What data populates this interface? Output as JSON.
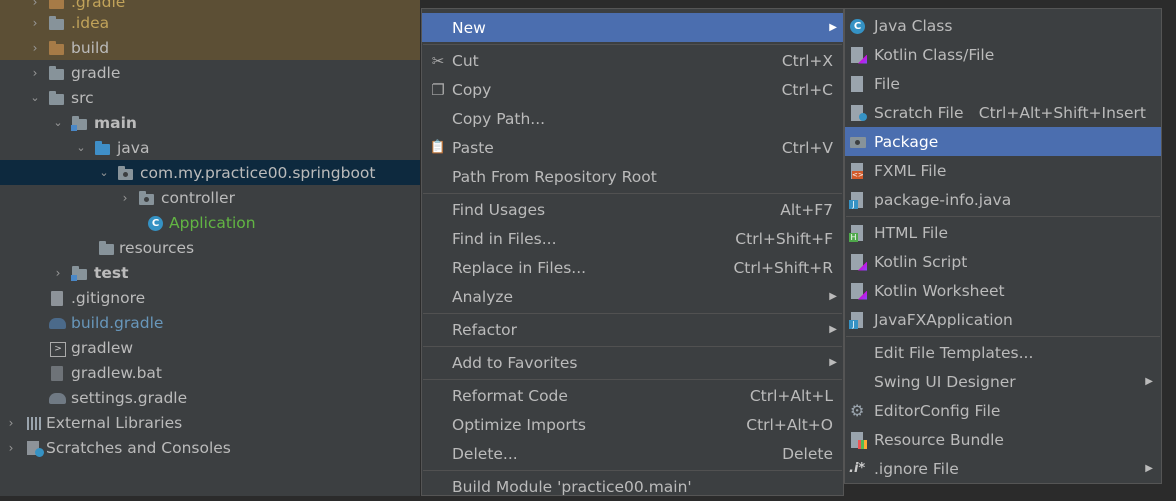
{
  "project_tree": {
    "items": [
      {
        "label": ".gradle",
        "arrow": "›",
        "icon": "folder-icon"
      },
      {
        "label": ".idea",
        "arrow": "›",
        "icon": "folder-icon"
      },
      {
        "label": "build",
        "arrow": "›",
        "icon": "folder-icon"
      },
      {
        "label": "gradle",
        "arrow": "›",
        "icon": "folder-icon"
      },
      {
        "label": "src",
        "arrow": "⌄",
        "icon": "folder-icon"
      },
      {
        "label": "main",
        "arrow": "⌄",
        "icon": "module-folder-icon"
      },
      {
        "label": "java",
        "arrow": "⌄",
        "icon": "source-folder-icon"
      },
      {
        "label": "com.my.practice00.springboot",
        "arrow": "⌄",
        "icon": "package-icon"
      },
      {
        "label": "controller",
        "arrow": "›",
        "icon": "package-icon"
      },
      {
        "label": "Application",
        "arrow": "",
        "icon": "spring-class-icon",
        "icon_char": "C"
      },
      {
        "label": "resources",
        "arrow": "",
        "icon": "resources-folder-icon"
      },
      {
        "label": "test",
        "arrow": "›",
        "icon": "module-folder-icon"
      },
      {
        "label": ".gitignore",
        "arrow": "",
        "icon": "file-icon"
      },
      {
        "label": "build.gradle",
        "arrow": "",
        "icon": "gradle-icon"
      },
      {
        "label": "gradlew",
        "arrow": "",
        "icon": "terminal-icon",
        "icon_char": ">"
      },
      {
        "label": "gradlew.bat",
        "arrow": "",
        "icon": "file-icon"
      },
      {
        "label": "settings.gradle",
        "arrow": "",
        "icon": "gradle-icon"
      },
      {
        "label": "External Libraries",
        "arrow": "›",
        "icon": "library-icon"
      },
      {
        "label": "Scratches and Consoles",
        "arrow": "›",
        "icon": "scratch-icon"
      }
    ]
  },
  "context_menu": {
    "items": [
      {
        "label": "New",
        "shortcut": "",
        "submenu_arrow": "▶",
        "icon": "",
        "active": true
      },
      {
        "label": "Cut",
        "shortcut": "Ctrl+X",
        "icon": "scissors-icon",
        "icon_char": "✂"
      },
      {
        "label": "Copy",
        "shortcut": "Ctrl+C",
        "icon": "copy-icon",
        "icon_char": "❐"
      },
      {
        "label": "Copy Path...",
        "shortcut": "",
        "icon": ""
      },
      {
        "label": "Paste",
        "shortcut": "Ctrl+V",
        "icon": "paste-icon",
        "icon_char": "📋"
      },
      {
        "label": "Path From Repository Root",
        "shortcut": "",
        "icon": ""
      },
      {
        "label": "Find Usages",
        "shortcut": "Alt+F7",
        "icon": ""
      },
      {
        "label": "Find in Files...",
        "shortcut": "Ctrl+Shift+F",
        "icon": ""
      },
      {
        "label": "Replace in Files...",
        "shortcut": "Ctrl+Shift+R",
        "icon": ""
      },
      {
        "label": "Analyze",
        "shortcut": "",
        "submenu_arrow": "▶",
        "icon": ""
      },
      {
        "label": "Refactor",
        "shortcut": "",
        "submenu_arrow": "▶",
        "icon": ""
      },
      {
        "label": "Add to Favorites",
        "shortcut": "",
        "submenu_arrow": "▶",
        "icon": ""
      },
      {
        "label": "Reformat Code",
        "shortcut": "Ctrl+Alt+L",
        "icon": ""
      },
      {
        "label": "Optimize Imports",
        "shortcut": "Ctrl+Alt+O",
        "icon": ""
      },
      {
        "label": "Delete...",
        "shortcut": "Delete",
        "icon": ""
      },
      {
        "label": "Build Module 'practice00.main'",
        "shortcut": "",
        "icon": ""
      }
    ]
  },
  "new_submenu": {
    "items": [
      {
        "label": "Java Class",
        "shortcut": "",
        "icon": "java-class-icon",
        "icon_char": "C"
      },
      {
        "label": "Kotlin Class/File",
        "shortcut": "",
        "icon": "kotlin-file-icon"
      },
      {
        "label": "File",
        "shortcut": "",
        "icon": "file-icon"
      },
      {
        "label": "Scratch File",
        "shortcut": "Ctrl+Alt+Shift+Insert",
        "icon": "scratch-file-icon"
      },
      {
        "label": "Package",
        "shortcut": "",
        "icon": "package-icon",
        "active": true
      },
      {
        "label": "FXML File",
        "shortcut": "",
        "icon": "fxml-file-icon"
      },
      {
        "label": "package-info.java",
        "shortcut": "",
        "icon": "java-file-icon"
      },
      {
        "label": "HTML File",
        "shortcut": "",
        "icon": "html-file-icon"
      },
      {
        "label": "Kotlin Script",
        "shortcut": "",
        "icon": "kotlin-script-icon"
      },
      {
        "label": "Kotlin Worksheet",
        "shortcut": "",
        "icon": "kotlin-worksheet-icon"
      },
      {
        "label": "JavaFXApplication",
        "shortcut": "",
        "icon": "javafx-icon"
      },
      {
        "label": "Edit File Templates...",
        "shortcut": "",
        "icon": ""
      },
      {
        "label": "Swing UI Designer",
        "shortcut": "",
        "submenu_arrow": "▶",
        "icon": ""
      },
      {
        "label": "EditorConfig File",
        "shortcut": "",
        "icon": "gear-icon",
        "icon_char": "⚙"
      },
      {
        "label": "Resource Bundle",
        "shortcut": "",
        "icon": "resource-bundle-icon"
      },
      {
        "label": ".ignore File",
        "shortcut": "",
        "submenu_arrow": "▶",
        "icon": "ignore-file-icon",
        "icon_char": ".i*"
      }
    ]
  },
  "colors": {
    "selection": "#4b6eaf",
    "tree_bg": "#3c3f41",
    "tree_selected": "#0d293e",
    "excluded_row": "#5c4f35"
  }
}
